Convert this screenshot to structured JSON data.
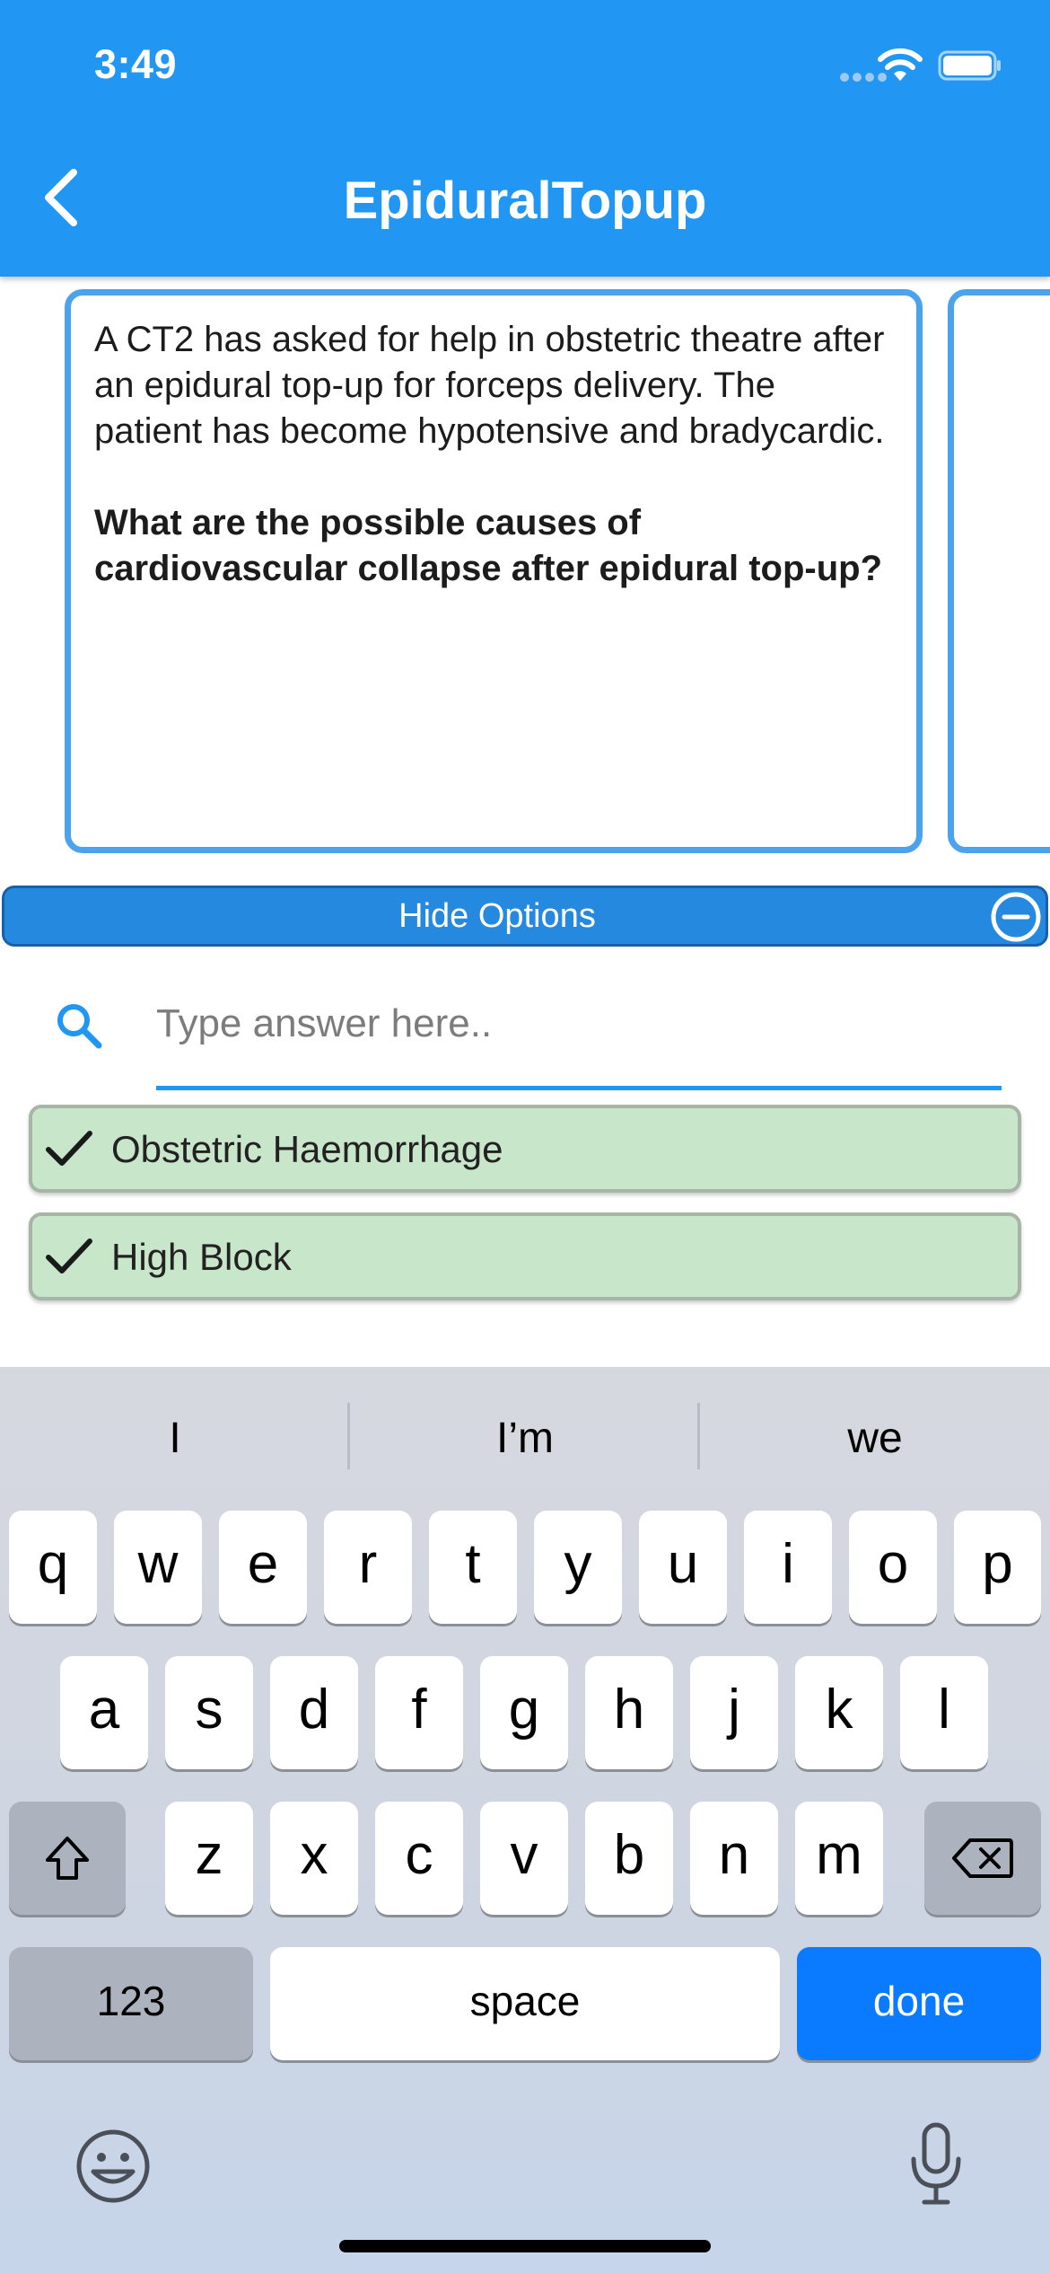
{
  "status_bar": {
    "time": "3:49"
  },
  "header": {
    "title": "EpiduralTopup"
  },
  "scenario": {
    "text": "A CT2 has asked for help in obstetric theatre after an epidural top-up for forceps delivery. The patient has become hypotensive and bradycardic.",
    "question": "What are the possible causes of cardiovascular collapse after epidural top-up?"
  },
  "options_bar": {
    "label": "Hide Options"
  },
  "answer_input": {
    "value": "",
    "placeholder": "Type answer here.."
  },
  "answers": [
    {
      "label": "Obstetric Haemorrhage",
      "correct": true
    },
    {
      "label": "High Block",
      "correct": true
    }
  ],
  "colors": {
    "primary": "#2196f3",
    "card_border": "#4aa3ec",
    "answer_bg": "#c8e6c9",
    "done_key": "#0a7aff"
  },
  "keyboard": {
    "suggestions": [
      "I",
      "I’m",
      "we"
    ],
    "row1": [
      "q",
      "w",
      "e",
      "r",
      "t",
      "y",
      "u",
      "i",
      "o",
      "p"
    ],
    "row2": [
      "a",
      "s",
      "d",
      "f",
      "g",
      "h",
      "j",
      "k",
      "l"
    ],
    "row3": [
      "z",
      "x",
      "c",
      "v",
      "b",
      "n",
      "m"
    ],
    "numbers_label": "123",
    "space_label": "space",
    "return_label": "done"
  }
}
